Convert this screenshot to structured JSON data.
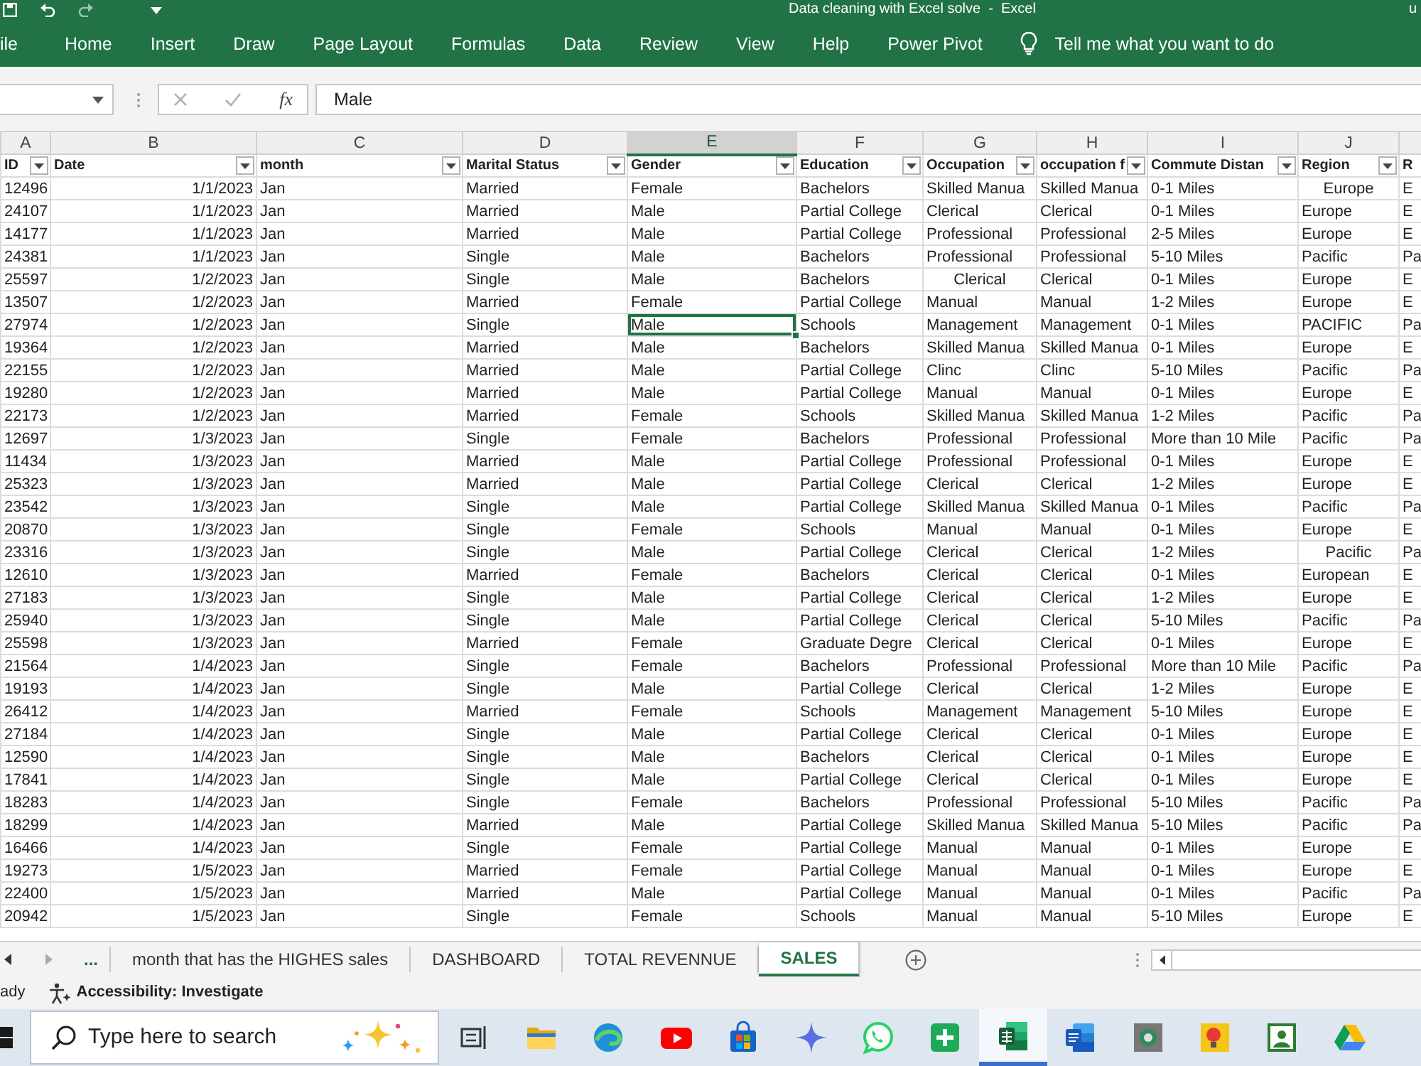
{
  "title_bar": {
    "title": "Data cleaning with Excel solve  -  Excel",
    "account": "u"
  },
  "ribbon": {
    "tabs": [
      {
        "label": "ile",
        "selected": false
      },
      {
        "label": "Home",
        "selected": false
      },
      {
        "label": "Insert",
        "selected": false
      },
      {
        "label": "Draw",
        "selected": false
      },
      {
        "label": "Page Layout",
        "selected": false
      },
      {
        "label": "Formulas",
        "selected": false
      },
      {
        "label": "Data",
        "selected": false
      },
      {
        "label": "Review",
        "selected": false
      },
      {
        "label": "View",
        "selected": false
      },
      {
        "label": "Help",
        "selected": false
      },
      {
        "label": "Power Pivot",
        "selected": false
      }
    ],
    "tell_me": "Tell me what you want to do"
  },
  "formula_bar": {
    "function_label": "fx",
    "formula": "Male"
  },
  "sheet": {
    "column_letters": [
      {
        "label": "A",
        "selected": false
      },
      {
        "label": "B",
        "selected": false
      },
      {
        "label": "C",
        "selected": false
      },
      {
        "label": "D",
        "selected": false
      },
      {
        "label": "E",
        "selected": true
      },
      {
        "label": "F",
        "selected": false
      },
      {
        "label": "G",
        "selected": false
      },
      {
        "label": "H",
        "selected": false
      },
      {
        "label": "I",
        "selected": false
      },
      {
        "label": "J",
        "selected": false
      }
    ],
    "columns": [
      {
        "label": "ID",
        "kind": "number",
        "filter": true
      },
      {
        "label": "Date",
        "kind": "date",
        "filter": true
      },
      {
        "label": "month",
        "kind": "text",
        "filter": true
      },
      {
        "label": "Marital Status",
        "kind": "text",
        "filter": true
      },
      {
        "label": "Gender",
        "kind": "text",
        "filter": true
      },
      {
        "label": "Education",
        "kind": "text",
        "filter": true
      },
      {
        "label": "Occupation",
        "kind": "text",
        "filter": true
      },
      {
        "label": "occupation f",
        "kind": "text",
        "filter": true
      },
      {
        "label": "Commute Distan",
        "kind": "text",
        "filter": true
      },
      {
        "label": "Region",
        "kind": "text",
        "filter": true
      },
      {
        "label": "R",
        "kind": "text",
        "filter": false
      }
    ],
    "rows": [
      {
        "selected": false,
        "cells": [
          "12496",
          "1/1/2023",
          "Jan",
          "Married",
          "Female",
          "Bachelors",
          "Skilled Manua",
          "Skilled Manua",
          "0-1 Miles",
          {
            "text": "Europe",
            "centered": true
          },
          "E"
        ]
      },
      {
        "selected": false,
        "cells": [
          "24107",
          "1/1/2023",
          "Jan",
          "Married",
          "Male",
          "Partial College",
          "Clerical",
          "Clerical",
          "0-1 Miles",
          "Europe",
          "E"
        ]
      },
      {
        "selected": false,
        "cells": [
          "14177",
          "1/1/2023",
          "Jan",
          "Married",
          "Male",
          "Partial College",
          "Professional",
          "Professional",
          "2-5 Miles",
          "Europe",
          "E"
        ]
      },
      {
        "selected": false,
        "cells": [
          "24381",
          "1/1/2023",
          "Jan",
          "Single",
          "Male",
          "Bachelors",
          "Professional",
          "Professional",
          "5-10 Miles",
          "Pacific",
          "Pa"
        ]
      },
      {
        "selected": false,
        "cells": [
          "25597",
          "1/2/2023",
          "Jan",
          "Single",
          "Male",
          "Bachelors",
          {
            "text": "Clerical",
            "centered": true
          },
          "Clerical",
          "0-1 Miles",
          "Europe",
          "E"
        ]
      },
      {
        "selected": false,
        "cells": [
          "13507",
          "1/2/2023",
          "Jan",
          "Married",
          "Female",
          "Partial College",
          "Manual",
          "Manual",
          "1-2 Miles",
          "Europe",
          "E"
        ]
      },
      {
        "selected": true,
        "cells": [
          "27974",
          "1/2/2023",
          "Jan",
          "Single",
          "Male",
          "Schools",
          "Management",
          "Management",
          "0-1 Miles",
          "PACIFIC",
          "Pa"
        ]
      },
      {
        "selected": false,
        "cells": [
          "19364",
          "1/2/2023",
          "Jan",
          "Married",
          "Male",
          "Bachelors",
          "Skilled Manua",
          "Skilled Manua",
          "0-1 Miles",
          "Europe",
          "E"
        ]
      },
      {
        "selected": false,
        "cells": [
          "22155",
          "1/2/2023",
          "Jan",
          "Married",
          "Male",
          "Partial College",
          "Clinc",
          "Clinc",
          "5-10 Miles",
          "Pacific",
          "Pa"
        ]
      },
      {
        "selected": false,
        "cells": [
          "19280",
          "1/2/2023",
          "Jan",
          "Married",
          "Male",
          "Partial College",
          "Manual",
          "Manual",
          "0-1 Miles",
          "Europe",
          "E"
        ]
      },
      {
        "selected": false,
        "cells": [
          "22173",
          "1/2/2023",
          "Jan",
          "Married",
          "Female",
          "Schools",
          "Skilled Manua",
          "Skilled Manua",
          "1-2 Miles",
          "Pacific",
          "Pa"
        ]
      },
      {
        "selected": false,
        "cells": [
          "12697",
          "1/3/2023",
          "Jan",
          "Single",
          "Female",
          "Bachelors",
          "Professional",
          "Professional",
          "More than 10 Mile",
          "Pacific",
          "Pa"
        ]
      },
      {
        "selected": false,
        "cells": [
          "11434",
          "1/3/2023",
          "Jan",
          "Married",
          "Male",
          "Partial College",
          "Professional",
          "Professional",
          "0-1 Miles",
          "Europe",
          "E"
        ]
      },
      {
        "selected": false,
        "cells": [
          "25323",
          "1/3/2023",
          "Jan",
          "Married",
          "Male",
          "Partial College",
          "Clerical",
          "Clerical",
          "1-2 Miles",
          "Europe",
          "E"
        ]
      },
      {
        "selected": false,
        "cells": [
          "23542",
          "1/3/2023",
          "Jan",
          "Single",
          "Male",
          "Partial College",
          "Skilled Manua",
          "Skilled Manua",
          "0-1 Miles",
          "Pacific",
          "Pa"
        ]
      },
      {
        "selected": false,
        "cells": [
          "20870",
          "1/3/2023",
          "Jan",
          "Single",
          "Female",
          "Schools",
          "Manual",
          "Manual",
          "0-1 Miles",
          "Europe",
          "E"
        ]
      },
      {
        "selected": false,
        "cells": [
          "23316",
          "1/3/2023",
          "Jan",
          "Single",
          "Male",
          "Partial College",
          "Clerical",
          "Clerical",
          "1-2 Miles",
          {
            "text": "Pacific",
            "centered": true
          },
          "Pa"
        ]
      },
      {
        "selected": false,
        "cells": [
          "12610",
          "1/3/2023",
          "Jan",
          "Married",
          "Female",
          "Bachelors",
          "Clerical",
          "Clerical",
          "0-1 Miles",
          "European",
          "E"
        ]
      },
      {
        "selected": false,
        "cells": [
          "27183",
          "1/3/2023",
          "Jan",
          "Single",
          "Male",
          "Partial College",
          "Clerical",
          "Clerical",
          "1-2 Miles",
          "Europe",
          "E"
        ]
      },
      {
        "selected": false,
        "cells": [
          "25940",
          "1/3/2023",
          "Jan",
          "Single",
          "Male",
          "Partial College",
          "Clerical",
          "Clerical",
          "5-10 Miles",
          "Pacific",
          "Pa"
        ]
      },
      {
        "selected": false,
        "cells": [
          "25598",
          "1/3/2023",
          "Jan",
          "Married",
          "Female",
          "Graduate Degre",
          "Clerical",
          "Clerical",
          "0-1 Miles",
          "Europe",
          "E"
        ]
      },
      {
        "selected": false,
        "cells": [
          "21564",
          "1/4/2023",
          "Jan",
          "Single",
          "Female",
          "Bachelors",
          "Professional",
          "Professional",
          "More than 10 Mile",
          "Pacific",
          "Pa"
        ]
      },
      {
        "selected": false,
        "cells": [
          "19193",
          "1/4/2023",
          "Jan",
          "Single",
          "Male",
          "Partial College",
          "Clerical",
          "Clerical",
          "1-2 Miles",
          "Europe",
          "E"
        ]
      },
      {
        "selected": false,
        "cells": [
          "26412",
          "1/4/2023",
          "Jan",
          "Married",
          "Female",
          "Schools",
          "Management",
          "Management",
          "5-10 Miles",
          "Europe",
          "E"
        ]
      },
      {
        "selected": false,
        "cells": [
          "27184",
          "1/4/2023",
          "Jan",
          "Single",
          "Male",
          "Partial College",
          "Clerical",
          "Clerical",
          "0-1 Miles",
          "Europe",
          "E"
        ]
      },
      {
        "selected": false,
        "cells": [
          "12590",
          "1/4/2023",
          "Jan",
          "Single",
          "Male",
          "Bachelors",
          "Clerical",
          "Clerical",
          "0-1 Miles",
          "Europe",
          "E"
        ]
      },
      {
        "selected": false,
        "cells": [
          "17841",
          "1/4/2023",
          "Jan",
          "Single",
          "Male",
          "Partial College",
          "Clerical",
          "Clerical",
          "0-1 Miles",
          "Europe",
          "E"
        ]
      },
      {
        "selected": false,
        "cells": [
          "18283",
          "1/4/2023",
          "Jan",
          "Single",
          "Female",
          "Bachelors",
          "Professional",
          "Professional",
          "5-10 Miles",
          "Pacific",
          "Pa"
        ]
      },
      {
        "selected": false,
        "cells": [
          "18299",
          "1/4/2023",
          "Jan",
          "Married",
          "Male",
          "Partial College",
          "Skilled Manua",
          "Skilled Manua",
          "5-10 Miles",
          "Pacific",
          "Pa"
        ]
      },
      {
        "selected": false,
        "cells": [
          "16466",
          "1/4/2023",
          "Jan",
          "Single",
          "Female",
          "Partial College",
          "Manual",
          "Manual",
          "0-1 Miles",
          "Europe",
          "E"
        ]
      },
      {
        "selected": false,
        "cells": [
          "19273",
          "1/5/2023",
          "Jan",
          "Married",
          "Female",
          "Partial College",
          "Manual",
          "Manual",
          "0-1 Miles",
          "Europe",
          "E"
        ]
      },
      {
        "selected": false,
        "cells": [
          "22400",
          "1/5/2023",
          "Jan",
          "Married",
          "Male",
          "Partial College",
          "Manual",
          "Manual",
          "0-1 Miles",
          "Pacific",
          "Pa"
        ]
      },
      {
        "selected": false,
        "cells": [
          "20942",
          "1/5/2023",
          "Jan",
          "Single",
          "Female",
          "Schools",
          "Manual",
          "Manual",
          "5-10 Miles",
          "Europe",
          "E"
        ]
      }
    ]
  },
  "sheet_tabs": {
    "more": "...",
    "tabs": [
      {
        "label": "month that has the HIGHES sales",
        "selected": false
      },
      {
        "label": "DASHBOARD",
        "selected": false
      },
      {
        "label": "TOTAL REVENNUE",
        "selected": false
      },
      {
        "label": "SALES",
        "selected": true
      }
    ]
  },
  "status_bar": {
    "mode": "ady",
    "accessibility": "Accessibility: Investigate"
  },
  "taskbar": {
    "search": {
      "placeholder": "Type here to search"
    },
    "apps": [
      {
        "active": false
      },
      {
        "active": false
      },
      {
        "active": false
      },
      {
        "active": false
      },
      {
        "active": false
      },
      {
        "active": false
      },
      {
        "active": false
      },
      {
        "active": false
      },
      {
        "active": true
      },
      {
        "active": false
      },
      {
        "active": false
      },
      {
        "active": false
      },
      {
        "active": false
      },
      {
        "active": false
      }
    ]
  }
}
